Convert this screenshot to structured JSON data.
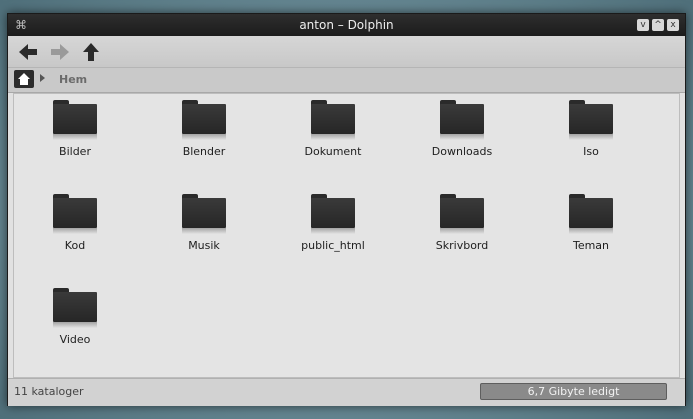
{
  "window": {
    "title": "anton – Dolphin",
    "buttons": [
      "v",
      "^",
      "x"
    ]
  },
  "toolbar": {
    "back_icon": "arrow-left-icon",
    "forward_icon": "arrow-right-icon",
    "up_icon": "arrow-up-icon"
  },
  "breadcrumb": {
    "home_icon": "home-icon",
    "label": "Hem"
  },
  "items": [
    {
      "label": "Bilder"
    },
    {
      "label": "Blender"
    },
    {
      "label": "Dokument"
    },
    {
      "label": "Downloads"
    },
    {
      "label": "Iso"
    },
    {
      "label": "Kod"
    },
    {
      "label": "Musik"
    },
    {
      "label": "public_html"
    },
    {
      "label": "Skrivbord"
    },
    {
      "label": "Teman"
    },
    {
      "label": "Video"
    }
  ],
  "status": {
    "text": "11 kataloger",
    "free_space": "6,7 Gibyte ledigt",
    "used_fraction": 0.0
  },
  "colors": {
    "titlebar": "#1c1c1c",
    "folder": "#2a2a2a",
    "background": "#e4e4e4"
  }
}
